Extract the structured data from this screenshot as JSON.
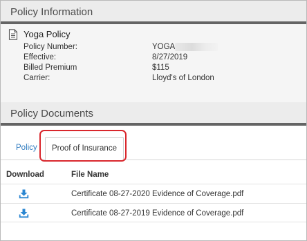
{
  "policy_information": {
    "header": "Policy Information",
    "policy_name": "Yoga Policy",
    "fields": [
      {
        "label": "Policy Number:",
        "value": "YOGA"
      },
      {
        "label": "Effective:",
        "value": "8/27/2019"
      },
      {
        "label": "Billed Premium",
        "value": "$115"
      },
      {
        "label": "Carrier:",
        "value": "Lloyd's of London"
      }
    ]
  },
  "policy_documents": {
    "header": "Policy Documents",
    "tabs": [
      {
        "label": "Policy",
        "active": false
      },
      {
        "label": "Proof of Insurance",
        "active": true
      }
    ],
    "columns": {
      "download": "Download",
      "file_name": "File Name"
    },
    "files": [
      {
        "name": "Certificate 08-27-2020 Evidence of Coverage.pdf"
      },
      {
        "name": "Certificate 08-27-2019 Evidence of Coverage.pdf"
      }
    ]
  },
  "icons": {
    "policy": "document-icon",
    "download": "download-icon"
  },
  "colors": {
    "link": "#2f7bbf",
    "download_icon": "#2a86d1",
    "highlight": "#d9262c",
    "header_rule": "#646464"
  }
}
